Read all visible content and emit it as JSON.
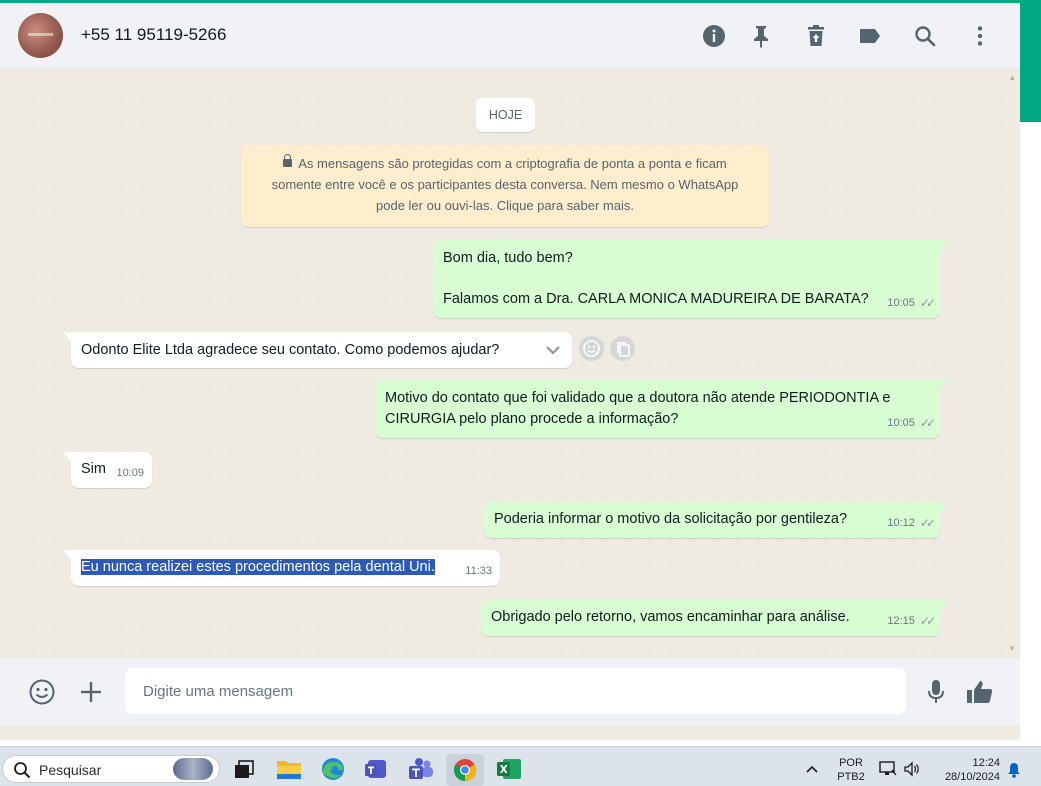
{
  "header": {
    "contact_name": "+55 11 95119-5266",
    "icons": [
      "info-icon",
      "pin-icon",
      "delete-icon",
      "label-icon",
      "search-icon",
      "menu-icon"
    ]
  },
  "chat": {
    "date_chip": "HOJE",
    "encryption_notice": "As mensagens são protegidas com a criptografia de ponta a ponta e ficam somente entre você e os participantes desta conversa. Nem mesmo o WhatsApp pode ler ou ouvi-las. Clique para saber mais.",
    "messages": [
      {
        "direction": "out",
        "line1": "Bom dia, tudo bem?",
        "line2": "Falamos com a Dra. CARLA MONICA MADUREIRA DE BARATA?",
        "time": "10:05"
      },
      {
        "direction": "in",
        "text": "Odonto Elite Ltda agradece seu contato. Como podemos ajudar?"
      },
      {
        "direction": "out",
        "line1": "Motivo do contato que foi validado que a doutora não atende PERIODONTIA e",
        "line2": "CIRURGIA pelo plano procede a informação?",
        "time": "10:05"
      },
      {
        "direction": "in",
        "text": "Sim",
        "time": "10:09"
      },
      {
        "direction": "out",
        "text": "Poderia informar o motivo da solicitação por gentileza?",
        "time": "10:12"
      },
      {
        "direction": "in",
        "text": "Eu nunca realizei estes procedimentos pela dental Uni.",
        "time": "11:33",
        "selected": true
      },
      {
        "direction": "out",
        "text": "Obrigado pelo retorno, vamos encaminhar para análise.",
        "time": "12:15"
      }
    ]
  },
  "footer": {
    "placeholder": "Digite uma mensagem"
  },
  "taskbar": {
    "search_label": "Pesquisar",
    "language_line1": "POR",
    "language_line2": "PTB2",
    "time": "12:24",
    "date": "28/10/2024"
  },
  "colors": {
    "accent": "#00a884",
    "outgoing_bubble": "#d9fdd3",
    "incoming_bubble": "#ffffff",
    "chat_background": "#efeae2",
    "notice_background": "#ffeecd",
    "selection": "#2d59b8"
  }
}
